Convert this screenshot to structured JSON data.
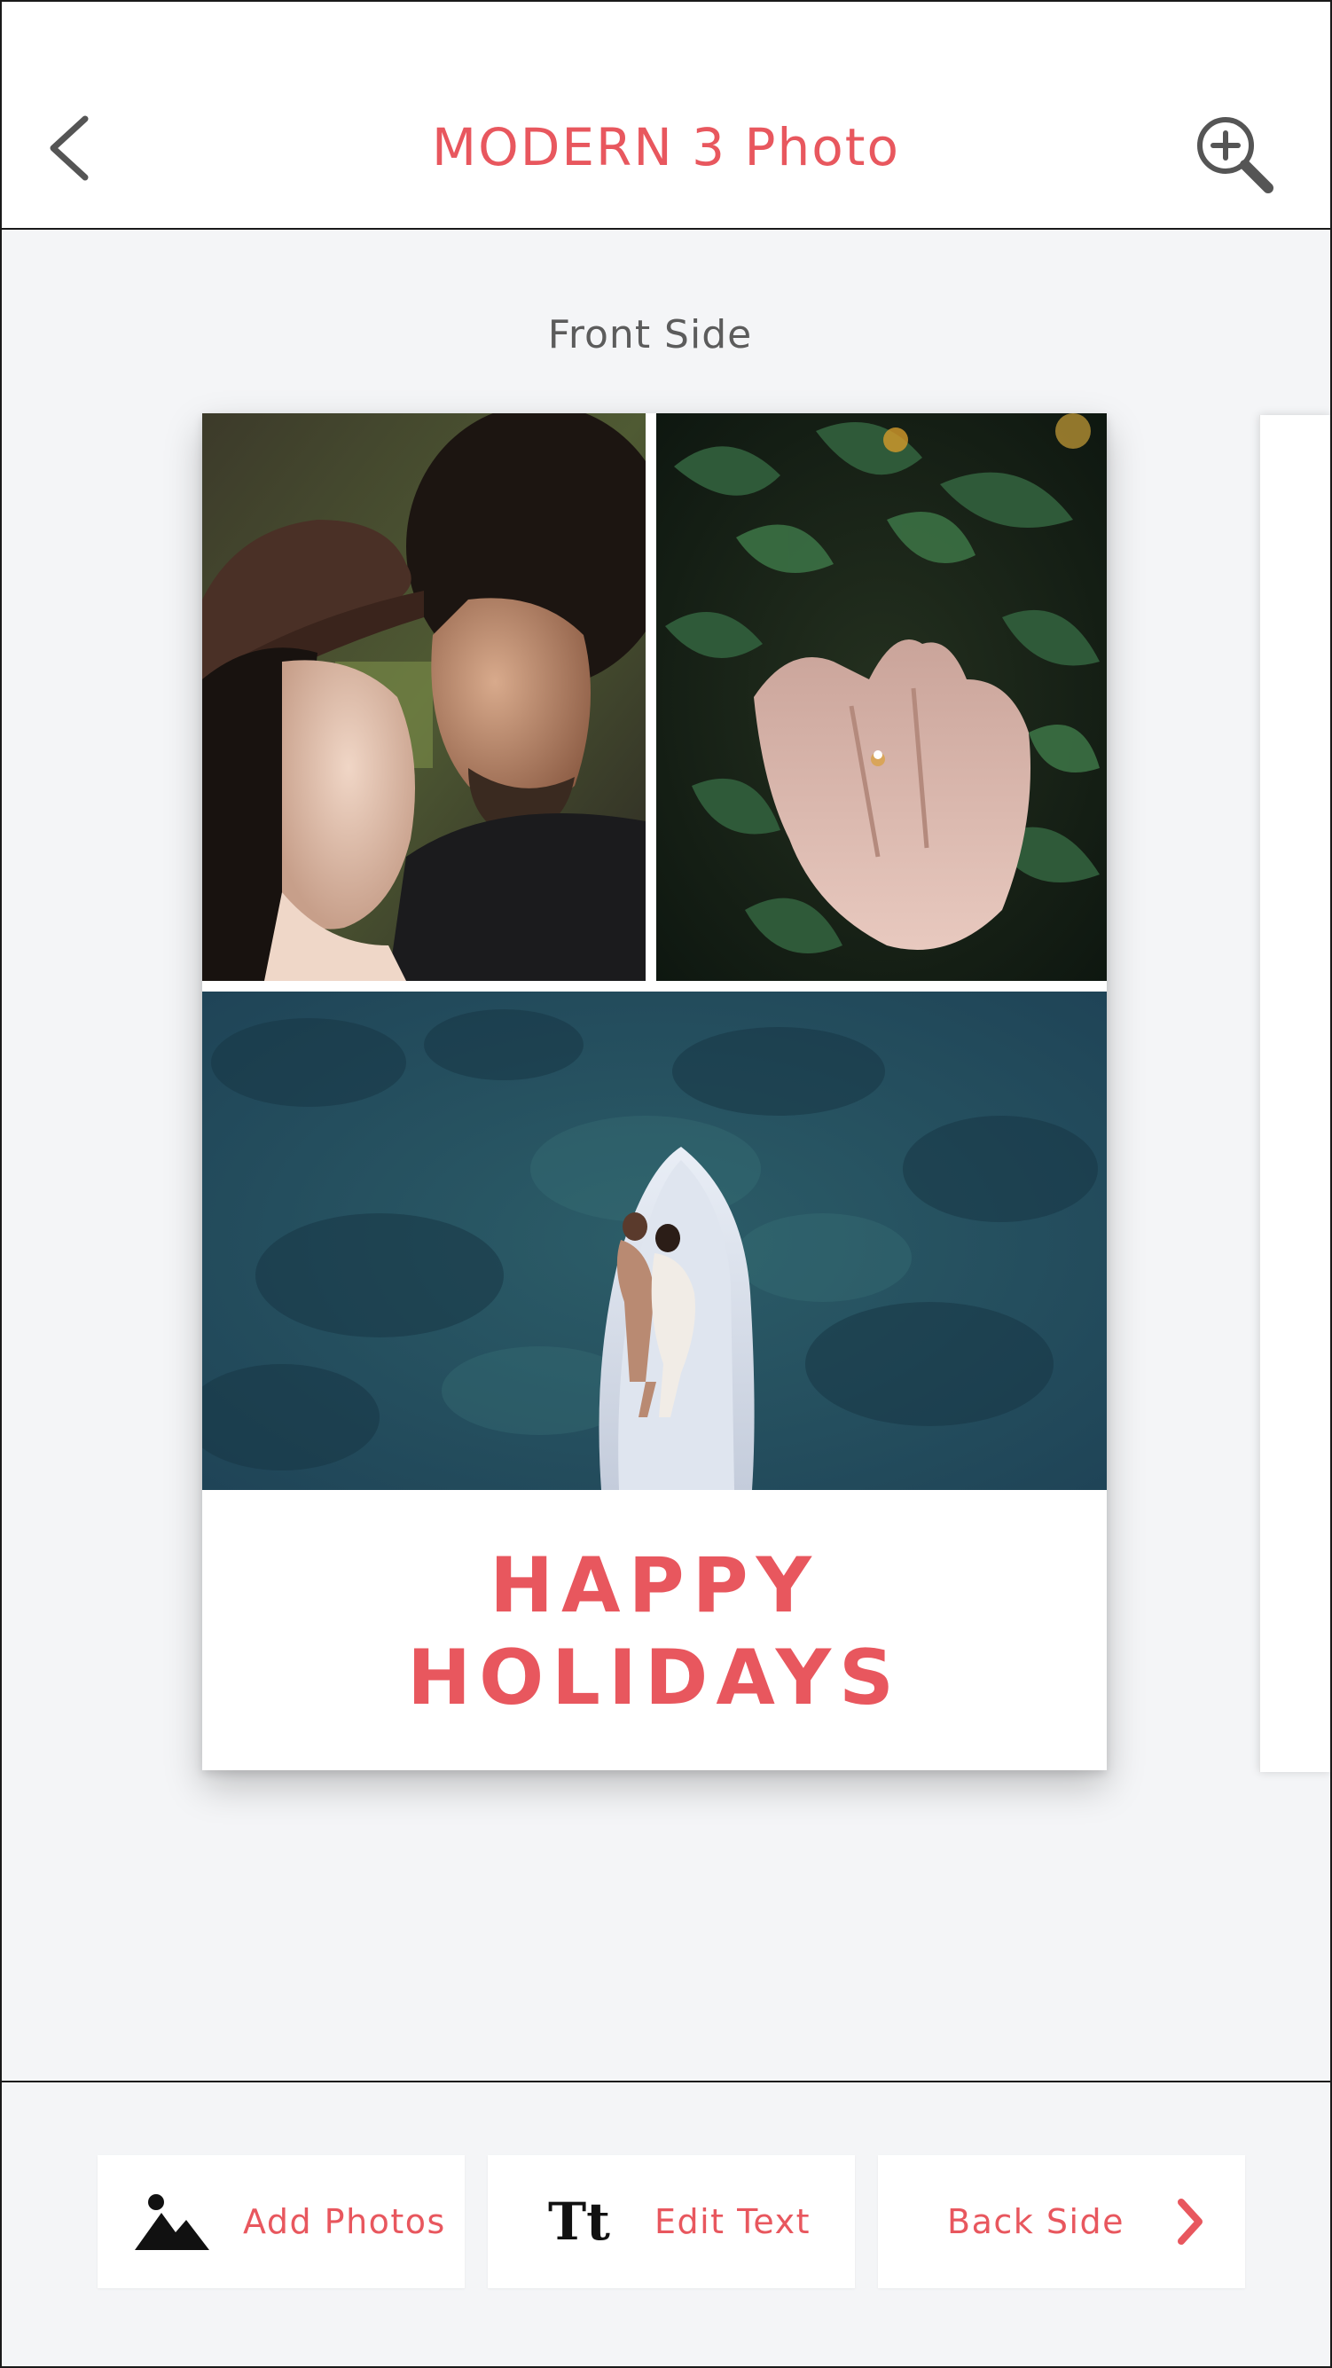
{
  "colors": {
    "accent": "#e8575e",
    "text_muted": "#5c5c5c"
  },
  "header": {
    "title": "MODERN 3 Photo",
    "back_icon": "chevron-left-icon",
    "zoom_icon": "zoom-in-icon"
  },
  "main": {
    "side_label": "Front Side",
    "card": {
      "greeting_line1": "HAPPY",
      "greeting_line2": "HOLIDAYS",
      "photos": [
        {
          "name": "couple-portrait-photo"
        },
        {
          "name": "hands-ring-photo"
        },
        {
          "name": "boat-aerial-photo"
        }
      ]
    }
  },
  "toolbar": {
    "add_photos_label": "Add Photos",
    "add_photos_icon": "mountain-image-icon",
    "edit_text_label": "Edit Text",
    "edit_text_icon": "Tt",
    "back_side_label": "Back Side",
    "back_side_icon": "chevron-right-icon"
  }
}
